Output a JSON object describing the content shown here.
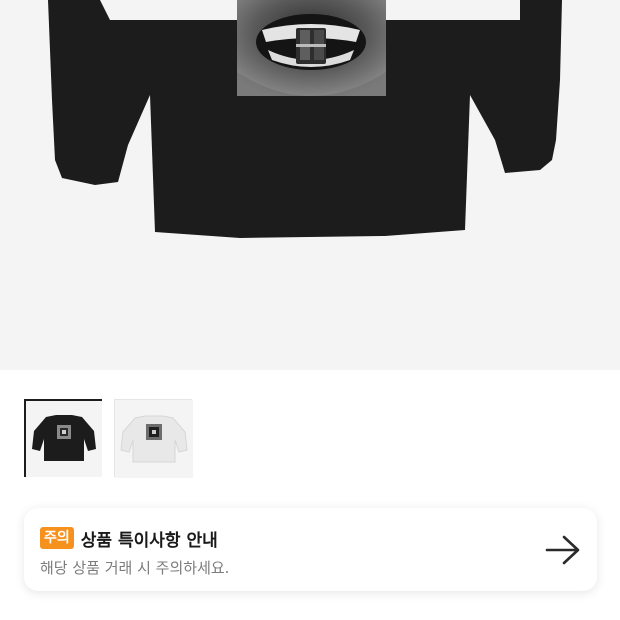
{
  "product": {
    "image_alt": "black long sleeve graphic tee with grillz mouth print",
    "thumbnails": [
      {
        "variant": "black",
        "selected": true
      },
      {
        "variant": "white",
        "selected": false
      }
    ]
  },
  "notice": {
    "badge": "주의",
    "title": "상품 특이사항 안내",
    "subtitle": "해당 상품 거래 시 주의하세요.",
    "badge_color": "#f7911e",
    "arrow_icon": "arrow-right-icon"
  }
}
